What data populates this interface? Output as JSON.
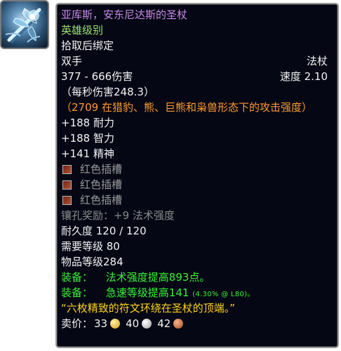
{
  "icon": {
    "name": "ice-staff-icon"
  },
  "tooltip": {
    "name": "亚库斯，安东尼达斯的圣杖",
    "quality": "英雄级别",
    "bind": "拾取后绑定",
    "slot": "双手",
    "type": "法杖",
    "damage": "377 - 666伤害",
    "speed": "速度 2.10",
    "dps": "（每秒伤害248.3）",
    "feral_power": "（2709 在猎豹、熊、巨熊和枭兽形态下的攻击强度）",
    "stats": [
      "+188 耐力",
      "+188 智力",
      "+141 精神"
    ],
    "sockets": [
      "红色插槽",
      "红色插槽",
      "红色插槽"
    ],
    "socket_bonus": "镶孔奖励：+9 法术强度",
    "durability": "耐久度 120 / 120",
    "required_level": "需要等级 80",
    "item_level": "物品等级284",
    "equip_1_prefix": "装备：",
    "equip_1_text": "法术强度提高893点。",
    "equip_2_prefix": "装备：",
    "equip_2_text": "急速等级提高141",
    "equip_2_note": "(4.30% @ L80)。",
    "flavor": "“六枚精致的符文环绕在圣杖的顶端。”",
    "sell_label": "卖价：",
    "price": {
      "gold": "33",
      "silver": "40",
      "copper": "42"
    }
  },
  "colors": {
    "name": "#c98ae8",
    "quality": "#9be26a",
    "orange": "#ff9a2f",
    "green": "#38f238",
    "flavor": "#ffd31a"
  }
}
